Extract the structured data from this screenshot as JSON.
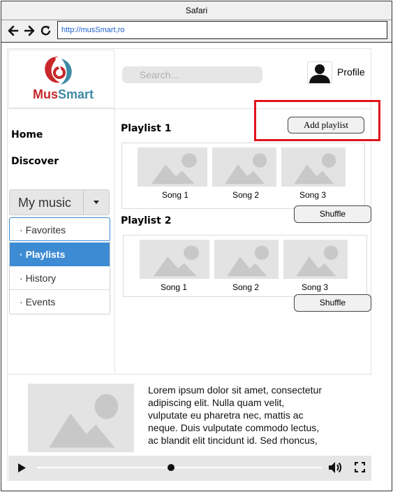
{
  "window": {
    "title": "Safari"
  },
  "browser": {
    "url": "http://musSmart,ro"
  },
  "brand": {
    "name_part1": "Mus",
    "name_part2": "Smart",
    "color_red": "#c8282b",
    "color_blue": "#3e8aa5"
  },
  "header": {
    "search_placeholder": "Search...",
    "profile_label": "Profile"
  },
  "sidebar": {
    "links": [
      "Home",
      "Discover"
    ],
    "dropdown_label": "My music",
    "menu": [
      {
        "label": "Favorites"
      },
      {
        "label": "Playlists"
      },
      {
        "label": "History"
      },
      {
        "label": "Events"
      }
    ]
  },
  "main": {
    "add_playlist_label": "Add playlist",
    "playlists": [
      {
        "title": "Playlist 1",
        "songs": [
          "Song 1",
          "Song 2",
          "Song 3"
        ],
        "shuffle_label": "Shuffle"
      },
      {
        "title": "Playlist 2",
        "songs": [
          "Song 1",
          "Song 2",
          "Song 3"
        ],
        "shuffle_label": "Shuffle"
      }
    ]
  },
  "player": {
    "description": "Lorem ipsum dolor sit amet, consectetur adipiscing elit. Nulla quam velit, vulputate eu pharetra nec, mattis ac neque. Duis vulputate commodo lectus, ac blandit elit tincidunt id. Sed rhoncus,",
    "description_lines": [
      "Lorem ipsum dolor sit amet, consectetur",
      "adipiscing elit. Nulla quam velit,",
      "vulputate eu pharetra nec, mattis ac",
      "neque. Duis vulputate commodo lectus,",
      "ac blandit elit tincidunt id. Sed rhoncus,"
    ],
    "progress": 0.47
  },
  "colors": {
    "accent": "#3d8bd3",
    "highlight": "#e0141d",
    "url_text": "#1d5fd1"
  }
}
